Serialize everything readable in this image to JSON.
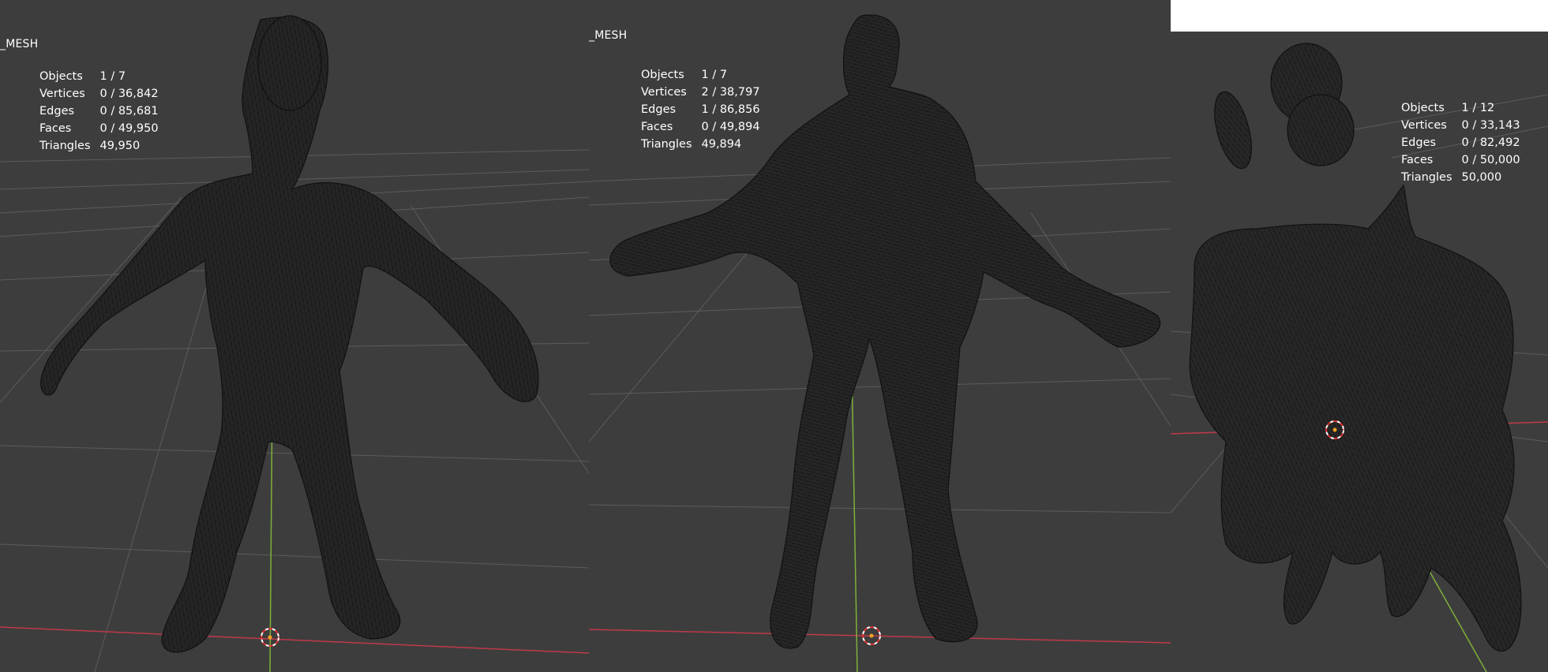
{
  "viewports": [
    {
      "object_label": "_MESH",
      "stats": [
        {
          "label": "Objects",
          "value": "1 / 7"
        },
        {
          "label": "Vertices",
          "value": "0 / 36,842"
        },
        {
          "label": "Edges",
          "value": "0 / 85,681"
        },
        {
          "label": "Faces",
          "value": "0 / 49,950"
        },
        {
          "label": "Triangles",
          "value": "49,950"
        }
      ]
    },
    {
      "object_label": "_MESH",
      "stats": [
        {
          "label": "Objects",
          "value": "1 / 7"
        },
        {
          "label": "Vertices",
          "value": "2 / 38,797"
        },
        {
          "label": "Edges",
          "value": "1 / 86,856"
        },
        {
          "label": "Faces",
          "value": "0 / 49,894"
        },
        {
          "label": "Triangles",
          "value": "49,894"
        }
      ]
    },
    {
      "object_label": "",
      "stats": [
        {
          "label": "Objects",
          "value": "1 / 12"
        },
        {
          "label": "Vertices",
          "value": "0 / 33,143"
        },
        {
          "label": "Edges",
          "value": "0 / 82,492"
        },
        {
          "label": "Faces",
          "value": "0 / 50,000"
        },
        {
          "label": "Triangles",
          "value": "50,000"
        }
      ]
    }
  ],
  "colors": {
    "background": "#3d3d3d",
    "grid": "#5c5c5c",
    "x_axis": "#c0394a",
    "y_axis": "#7fb03a",
    "mesh_fill": "#262626",
    "mesh_wire": "#111111",
    "cursor_red": "#e03030",
    "cursor_white": "#ffffff"
  }
}
